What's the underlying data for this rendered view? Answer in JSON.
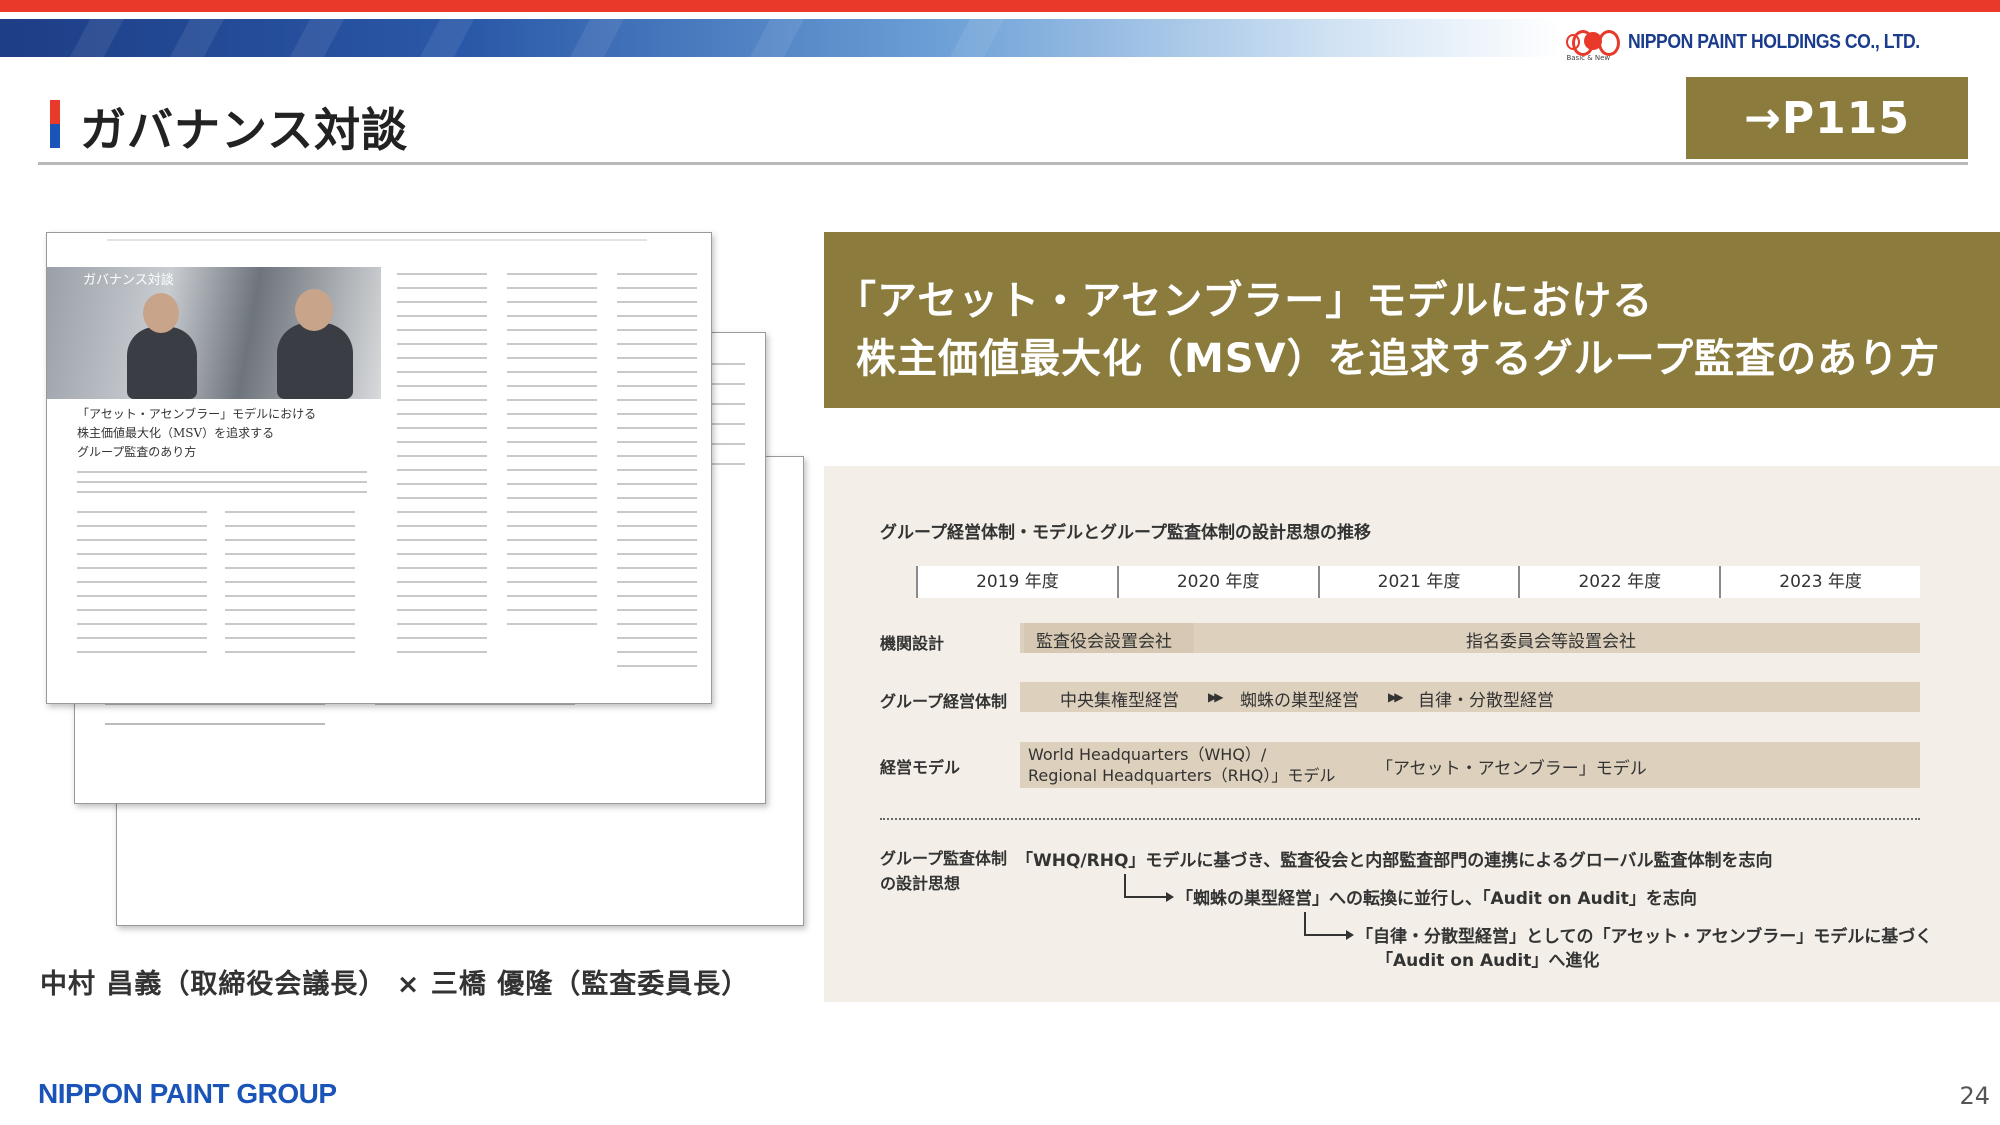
{
  "header": {
    "company_logo_text": "NIPPON PAINT HOLDINGS CO., LTD.",
    "logo_tagline": "Basic & New",
    "page_title": "ガバナンス対談",
    "page_reference": "→P115"
  },
  "magazine": {
    "section_label": "ガバナンス対談",
    "headline_lines": [
      "「アセット・アセンブラー」モデルにおける",
      "株主価値最大化（MSV）を追求する",
      "グループ監査のあり方"
    ],
    "guests_caption": "中村 昌義（取締役会議長） × 三橋 優隆（監査委員長）"
  },
  "headline": {
    "line1": "「アセット・アセンブラー」モデルにおける",
    "line2": "株主価値最大化（MSV）を追求するグループ監査のあり方"
  },
  "panel": {
    "title": "グループ経営体制・モデルとグループ監査体制の設計思想の推移",
    "years": [
      "2019 年度",
      "2020 年度",
      "2021 年度",
      "2022 年度",
      "2023 年度"
    ],
    "rows": {
      "organization": {
        "label": "機関設計",
        "stage1": "監査役会設置会社",
        "stage2": "指名委員会等設置会社"
      },
      "group_structure": {
        "label": "グループ経営体制",
        "stage1": "中央集権型経営",
        "stage2": "蜘蛛の巣型経営",
        "stage3": "自律・分散型経営"
      },
      "business_model": {
        "label": "経営モデル",
        "stage1_line1": "World Headquarters（WHQ）/",
        "stage1_line2": "Regional Headquarters（RHQ）」モデル",
        "stage2": "「アセット・アセンブラー」モデル"
      }
    },
    "philosophy": {
      "label_line1": "グループ監査体制",
      "label_line2": "の設計思想",
      "line1": "「WHQ/RHQ」モデルに基づき、監査役会と内部監査部門の連携によるグローバル監査体制を志向",
      "line2": "「蜘蛛の巣型経営」への転換に並行し、「Audit on Audit」を志向",
      "line3a": "「自律・分散型経営」としての「アセット・アセンブラー」モデルに基づく",
      "line3b": "「Audit on Audit」へ進化"
    }
  },
  "footer": {
    "group_logo": "NIPPON PAINT GROUP",
    "page_number": "24"
  },
  "colors": {
    "accent_gold": "#8b7b3d",
    "brand_red": "#e8392a",
    "brand_blue": "#1a54b8",
    "panel_bg": "#f3efe8",
    "bar_fill": "#ddd0bd"
  }
}
